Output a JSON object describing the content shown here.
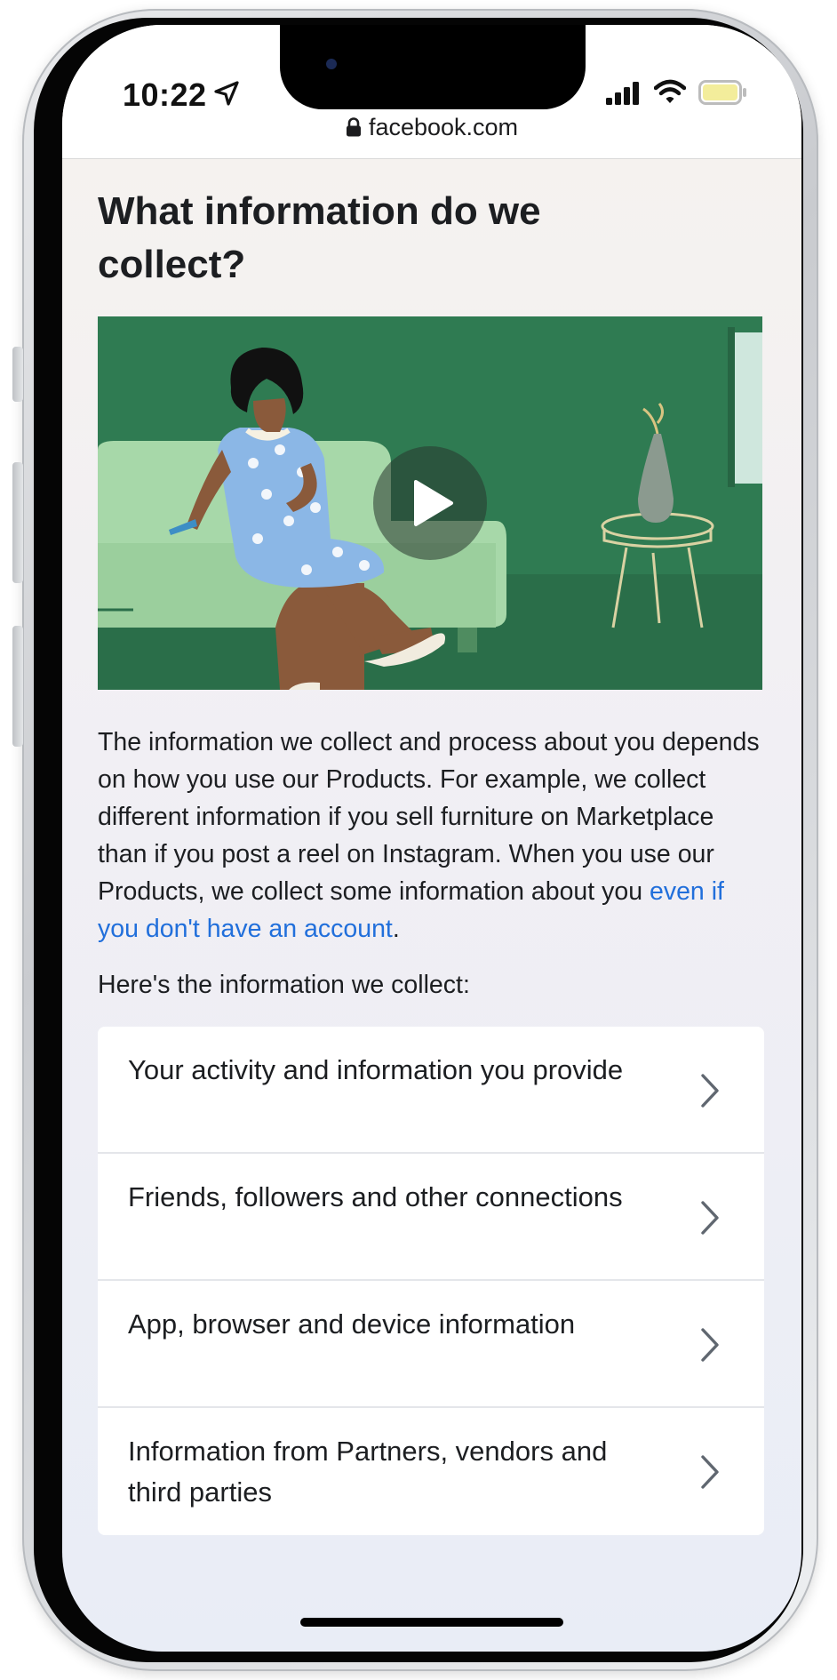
{
  "status_bar": {
    "time": "10:22",
    "icons": [
      "location-arrow-icon",
      "cellular-signal-icon",
      "wifi-icon",
      "battery-icon"
    ]
  },
  "browser": {
    "url": "facebook.com",
    "url_icon": "lock-icon"
  },
  "page": {
    "title": "What information do we collect?",
    "video": {
      "play_icon": "play-icon"
    },
    "intro_text": "The information we collect and process about you depends on how you use our Products. For example, we collect different information if you sell furniture on Marketplace than if you post a reel on Instagram. When you use our Products, we collect some information about you ",
    "intro_link": "even if you don't have an account",
    "intro_end": ".",
    "subhead": "Here's the information we collect:",
    "items": [
      {
        "label": "Your activity and information you provide"
      },
      {
        "label": "Friends, followers and other connections"
      },
      {
        "label": "App, browser and device information"
      },
      {
        "label": "Information from Partners, vendors and third parties"
      }
    ]
  },
  "colors": {
    "link": "#216fdb",
    "text": "#1c1e21",
    "video_bg": "#2e7a52"
  }
}
